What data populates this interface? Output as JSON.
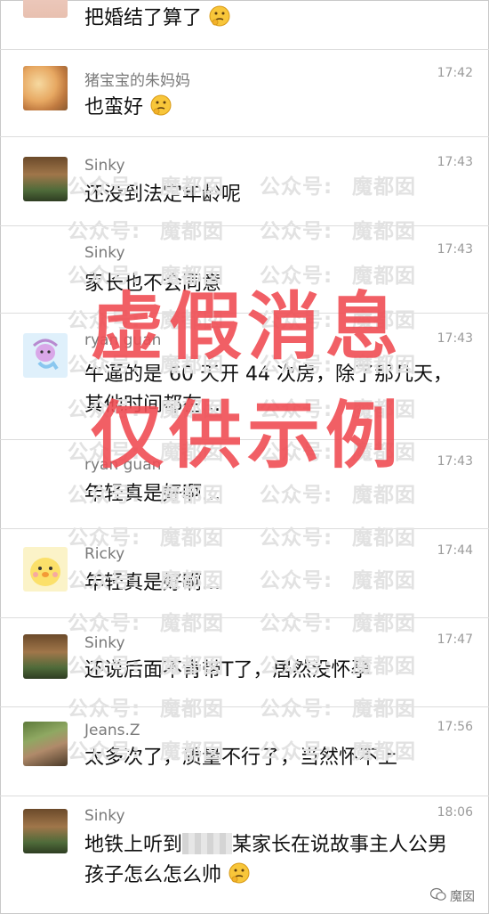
{
  "messages": [
    {
      "sender": "",
      "time": "",
      "text": "把婚结了算了",
      "emoji": "thinking-face"
    },
    {
      "sender": "猪宝宝的朱妈妈",
      "time": "17:42",
      "text": "也蛮好",
      "emoji": "thinking-face"
    },
    {
      "sender": "Sinky",
      "time": "17:43",
      "text": "还没到法定年龄呢"
    },
    {
      "sender": "Sinky",
      "time": "17:43",
      "text": "家长也不会同意"
    },
    {
      "sender": "ryan guan",
      "time": "17:43",
      "text": "牛逼的是 60 天开 44 次房，除了那几天，其他时间都在..."
    },
    {
      "sender": "ryan guan",
      "time": "17:43",
      "text": "年轻真是好啊..."
    },
    {
      "sender": "Ricky",
      "time": "17:44",
      "text": "年轻真是好啊..."
    },
    {
      "sender": "Sinky",
      "time": "17:47",
      "text": "还说后面不肯带T了，居然没怀孕"
    },
    {
      "sender": "Jeans.Z",
      "time": "17:56",
      "text": "太多次了，质量不行了，当然怀不上"
    },
    {
      "sender": "Sinky",
      "time": "18:06",
      "text_before": "地铁上听到",
      "text_after": "某家长在说故事主人公男孩子怎么怎么帅",
      "emoji": "thinking-face"
    }
  ],
  "overlay": {
    "line1": "虚假消息",
    "line2": "仅供示例"
  },
  "watermark": {
    "left": "公众号:",
    "right": "魔都囡"
  },
  "footer": {
    "brand": "魔囡",
    "icon": "wechat-icon"
  },
  "colors": {
    "stamp": "#ef4e54",
    "watermark": "#e2e2e2",
    "divider": "#dcdcdc"
  }
}
